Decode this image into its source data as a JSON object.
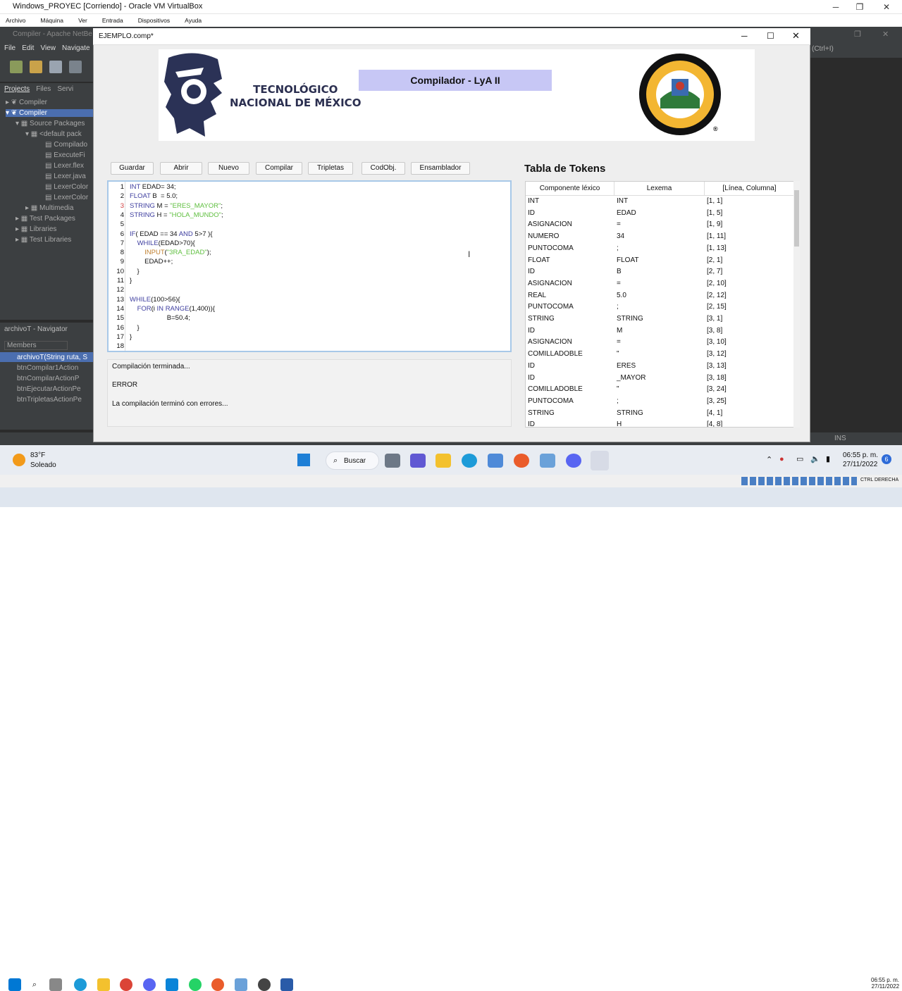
{
  "host": {
    "title": "Windows_PROYEC [Corriendo] - Oracle VM VirtualBox",
    "menu": [
      "Archivo",
      "Máquina",
      "Ver",
      "Entrada",
      "Dispositivos",
      "Ayuda"
    ],
    "time": "06:55 p. m.",
    "date": "27/11/2022",
    "ctrl": "CTRL DERECHA"
  },
  "netbeans": {
    "title": "Compiler - Apache NetBe",
    "menu": [
      "File",
      "Edit",
      "View",
      "Navigate"
    ],
    "tabs": [
      "Projects",
      "Files",
      "Servi"
    ],
    "tree": [
      {
        "label": "Compiler",
        "sel": false
      },
      {
        "label": "Compiler",
        "sel": true
      },
      {
        "label": "Source Packages",
        "sel": false
      },
      {
        "label": "<default pack",
        "sel": false
      },
      {
        "label": "Compilado",
        "sel": false
      },
      {
        "label": "ExecuteFi",
        "sel": false
      },
      {
        "label": "Lexer.flex",
        "sel": false
      },
      {
        "label": "Lexer.java",
        "sel": false
      },
      {
        "label": "LexerColor",
        "sel": false
      },
      {
        "label": "LexerColor",
        "sel": false
      },
      {
        "label": "Multimedia",
        "sel": false
      },
      {
        "label": "Test Packages",
        "sel": false
      },
      {
        "label": "Libraries",
        "sel": false
      },
      {
        "label": "Test Libraries",
        "sel": false
      }
    ],
    "navigator_title": "archivoT - Navigator",
    "members_label": "Members",
    "members": [
      "archivoT(String ruta, S",
      "btnCompilar1Action",
      "btnCompilarActionP",
      "btnEjecutarActionPe",
      "btnTripletasActionPe"
    ],
    "hint": "(Ctrl+I)",
    "ins": "INS"
  },
  "app": {
    "title": "EJEMPLO.comp*",
    "banner_title": "Compilador - LyA II",
    "tec_line1": "TECNOLÓGICO",
    "tec_line2": "NACIONAL DE MÉXICO",
    "seal_top": "INSTITUTO TECNOLÓGICO",
    "seal_bottom": "DE TEPIC",
    "buttons": [
      "Guardar",
      "Abrir",
      "Nuevo",
      "Compilar",
      "Tripletas",
      "CodObj.",
      "Ensamblador"
    ],
    "console": [
      "Compilación terminada...",
      "ERROR",
      "La compilación terminó con errores..."
    ],
    "tokens_title": "Tabla de Tokens",
    "tokens_headers": [
      "Componente léxico",
      "Lexema",
      "[Línea, Columna]"
    ],
    "tokens": [
      [
        "INT",
        "INT",
        "[1, 1]"
      ],
      [
        "ID",
        "EDAD",
        "[1, 5]"
      ],
      [
        "ASIGNACION",
        "=",
        "[1, 9]"
      ],
      [
        "NUMERO",
        "34",
        "[1, 11]"
      ],
      [
        "PUNTOCOMA",
        ";",
        "[1, 13]"
      ],
      [
        "FLOAT",
        "FLOAT",
        "[2, 1]"
      ],
      [
        "ID",
        "B",
        "[2, 7]"
      ],
      [
        "ASIGNACION",
        "=",
        "[2, 10]"
      ],
      [
        "REAL",
        "5.0",
        "[2, 12]"
      ],
      [
        "PUNTOCOMA",
        ";",
        "[2, 15]"
      ],
      [
        "STRING",
        "STRING",
        "[3, 1]"
      ],
      [
        "ID",
        "M",
        "[3, 8]"
      ],
      [
        "ASIGNACION",
        "=",
        "[3, 10]"
      ],
      [
        "COMILLADOBLE",
        "\"",
        "[3, 12]"
      ],
      [
        "ID",
        "ERES",
        "[3, 13]"
      ],
      [
        "ID",
        "_MAYOR",
        "[3, 18]"
      ],
      [
        "COMILLADOBLE",
        "\"",
        "[3, 24]"
      ],
      [
        "PUNTOCOMA",
        ";",
        "[3, 25]"
      ],
      [
        "STRING",
        "STRING",
        "[4, 1]"
      ],
      [
        "ID",
        "H",
        "[4, 8]"
      ]
    ]
  },
  "code_lines": [
    {
      "n": "1",
      "parts": [
        [
          "kw",
          "INT"
        ],
        [
          "",
          " EDAD= 34;"
        ]
      ]
    },
    {
      "n": "2",
      "parts": [
        [
          "kw",
          "FLOAT"
        ],
        [
          "",
          " B  = 5.0;"
        ]
      ]
    },
    {
      "n": "3",
      "parts": [
        [
          "kw",
          "STRING"
        ],
        [
          "",
          " M = "
        ],
        [
          "str",
          "\"ERES_MAYOR\""
        ],
        [
          "",
          ";"
        ]
      ]
    },
    {
      "n": "4",
      "parts": [
        [
          "kw",
          "STRING"
        ],
        [
          "",
          " H = "
        ],
        [
          "str",
          "\"HOLA_MUNDO\""
        ],
        [
          "",
          ";"
        ]
      ]
    },
    {
      "n": "5",
      "parts": []
    },
    {
      "n": "6",
      "parts": [
        [
          "kw",
          "IF"
        ],
        [
          "",
          "( EDAD == 34 "
        ],
        [
          "kw",
          "AND"
        ],
        [
          "",
          " 5>7 ){"
        ]
      ]
    },
    {
      "n": "7",
      "parts": [
        [
          "",
          "    "
        ],
        [
          "kw",
          "WHILE"
        ],
        [
          "",
          "(EDAD>70){"
        ]
      ]
    },
    {
      "n": "8",
      "parts": [
        [
          "",
          "        "
        ],
        [
          "fn",
          "INPUT"
        ],
        [
          "",
          "("
        ],
        [
          "str",
          "\"3RA_EDAD\""
        ],
        [
          "",
          ");"
        ]
      ]
    },
    {
      "n": "9",
      "parts": [
        [
          "",
          "        EDAD++;"
        ]
      ]
    },
    {
      "n": "10",
      "parts": [
        [
          "",
          "    }"
        ]
      ]
    },
    {
      "n": "11",
      "parts": [
        [
          "",
          "}"
        ]
      ]
    },
    {
      "n": "12",
      "parts": []
    },
    {
      "n": "13",
      "parts": [
        [
          "kw",
          "WHILE"
        ],
        [
          "",
          "(100>56){"
        ]
      ]
    },
    {
      "n": "14",
      "parts": [
        [
          "",
          "    "
        ],
        [
          "kw",
          "FOR"
        ],
        [
          "",
          "(i "
        ],
        [
          "kw",
          "IN"
        ],
        [
          "",
          " "
        ],
        [
          "kw",
          "RANGE"
        ],
        [
          "",
          "(1,400)){"
        ]
      ]
    },
    {
      "n": "15",
      "parts": [
        [
          "",
          "                    B=50.4;"
        ]
      ]
    },
    {
      "n": "16",
      "parts": [
        [
          "",
          "    }"
        ]
      ]
    },
    {
      "n": "17",
      "parts": [
        [
          "",
          "}"
        ]
      ]
    },
    {
      "n": "18",
      "parts": []
    }
  ],
  "taskbar": {
    "weather_temp": "83°F",
    "weather_desc": "Soleado",
    "search": "Buscar",
    "time": "06:55 p. m.",
    "date": "27/11/2022",
    "badge": "6"
  }
}
